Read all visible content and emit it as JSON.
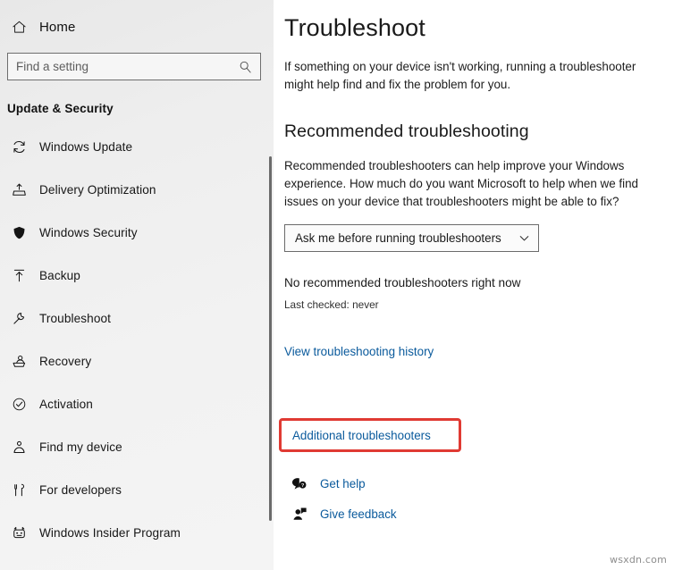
{
  "sidebar": {
    "home": {
      "label": "Home",
      "icon": "home-icon"
    },
    "search": {
      "placeholder": "Find a setting",
      "value": "",
      "icon": "search-icon"
    },
    "section_title": "Update & Security",
    "items": [
      {
        "label": "Windows Update",
        "icon": "refresh-icon"
      },
      {
        "label": "Delivery Optimization",
        "icon": "upload-box-icon"
      },
      {
        "label": "Windows Security",
        "icon": "shield-icon"
      },
      {
        "label": "Backup",
        "icon": "backup-upload-icon"
      },
      {
        "label": "Troubleshoot",
        "icon": "wrench-icon"
      },
      {
        "label": "Recovery",
        "icon": "recovery-icon"
      },
      {
        "label": "Activation",
        "icon": "check-circle-icon"
      },
      {
        "label": "Find my device",
        "icon": "person-pin-icon"
      },
      {
        "label": "For developers",
        "icon": "tools-icon"
      },
      {
        "label": "Windows Insider Program",
        "icon": "insider-icon"
      }
    ]
  },
  "main": {
    "title": "Troubleshoot",
    "description": "If something on your device isn't working, running a troubleshooter might help find and fix the problem for you.",
    "recommended": {
      "heading": "Recommended troubleshooting",
      "description": "Recommended troubleshooters can help improve your Windows experience. How much do you want Microsoft to help when we find issues on your device that troubleshooters might be able to fix?",
      "dropdown_value": "Ask me before running troubleshooters",
      "status": "No recommended troubleshooters right now",
      "last_checked": "Last checked: never"
    },
    "links": {
      "history": "View troubleshooting history",
      "additional": "Additional troubleshooters"
    },
    "help": [
      {
        "label": "Get help",
        "icon": "get-help-icon"
      },
      {
        "label": "Give feedback",
        "icon": "give-feedback-icon"
      }
    ]
  },
  "annotation": {
    "highlight_color": "#e03a33",
    "arrow_color": "#e03a33"
  },
  "watermark": "wsxdn.com"
}
